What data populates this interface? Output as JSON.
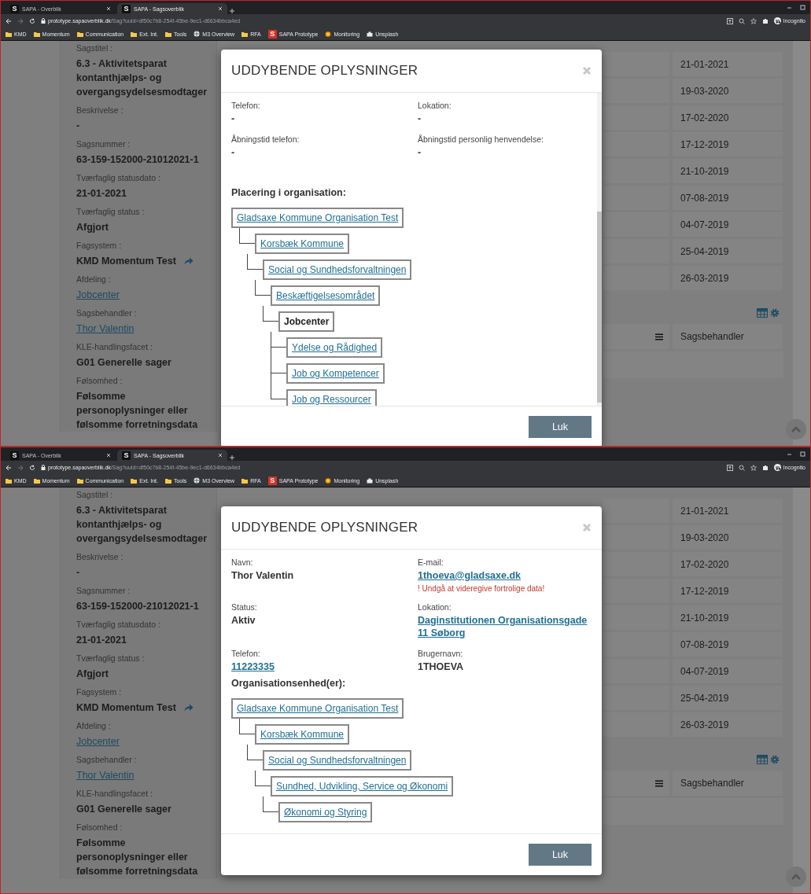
{
  "screens": [
    {
      "browser": {
        "tabs": [
          {
            "title": "SAPA - Overblik",
            "favicon": "S",
            "selected": false
          },
          {
            "title": "SAPA - Sagsoverblik",
            "favicon": "S",
            "selected": true
          }
        ],
        "url_host": "prototype.sapaoverblik.dk",
        "url_path": "/Sag?uuid=df50c7b8-254f-45be-9ec1-d6634bbca4ed",
        "bookmarks": [
          {
            "label": "KMD",
            "kind": "folder"
          },
          {
            "label": "Momentum",
            "kind": "folder"
          },
          {
            "label": "Communication",
            "kind": "folder"
          },
          {
            "label": "Ext. Int.",
            "kind": "folder"
          },
          {
            "label": "Tools",
            "kind": "folder"
          },
          {
            "label": "M3 Overview",
            "kind": "globe"
          },
          {
            "label": "RFA",
            "kind": "folder"
          },
          {
            "label": "SAPA Prototype",
            "kind": "sapa",
            "icon_letter": "S"
          },
          {
            "label": "Monitoring",
            "kind": "monitor"
          },
          {
            "label": "Unsplash",
            "kind": "camera"
          }
        ],
        "profile": "Incognito"
      },
      "case_card": {
        "fields": [
          {
            "label": "Sagstitel :",
            "value": "6.3 - Aktivitetsparat kontanthjælps- og overgangsydelsesmodtager",
            "kind": "text"
          },
          {
            "label": "Beskrivelse :",
            "value": "-",
            "kind": "text"
          },
          {
            "label": "Sagsnummer :",
            "value": "63-159-152000-21012021-1",
            "kind": "text"
          },
          {
            "label": "Tværfaglig statusdato :",
            "value": "21-01-2021",
            "kind": "text"
          },
          {
            "label": "Tværfaglig status :",
            "value": "Afgjort",
            "kind": "text"
          },
          {
            "label": "Fagsystem :",
            "value": "KMD Momentum Test",
            "kind": "external"
          },
          {
            "label": "Afdeling :",
            "value": "Jobcenter",
            "kind": "link"
          },
          {
            "label": "Sagsbehandler :",
            "value": "Thor Valentin",
            "kind": "link"
          },
          {
            "label": "KLE-handlingsfacet :",
            "value": "G01 Generelle sager",
            "kind": "text"
          },
          {
            "label": "Følsomhed :",
            "value": "Følsomme personoplysninger eller følsomme forretningsdata",
            "kind": "text"
          }
        ]
      },
      "case_table": {
        "dates": [
          "21-01-2021",
          "19-03-2020",
          "17-02-2020",
          "17-12-2019",
          "21-10-2019",
          "07-08-2019",
          "04-07-2019",
          "25-04-2019",
          "26-03-2019"
        ],
        "column_header": "Sagsbehandler"
      },
      "modal": {
        "title": "UDDYBENDE OPLYSNINGER",
        "scrolled": true,
        "fields": [
          {
            "label": "Telefon:",
            "value": "-",
            "kind": "text"
          },
          {
            "label": "Lokation:",
            "value": "-",
            "kind": "text"
          },
          {
            "label": "Åbningstid telefon:",
            "value": "-",
            "kind": "text"
          },
          {
            "label": "Åbningstid personlig henvendelse:",
            "value": "-",
            "kind": "text"
          }
        ],
        "section_title": "Placering i organisation:",
        "tree": {
          "label": "Gladsaxe Kommune Organisation Test",
          "kind": "link",
          "children": [
            {
              "label": "Korsbæk Kommune",
              "kind": "link",
              "children": [
                {
                  "label": "Social og Sundhedsforvaltningen",
                  "kind": "link",
                  "children": [
                    {
                      "label": "Beskæftigelsesområdet",
                      "kind": "link",
                      "children": [
                        {
                          "label": "Jobcenter",
                          "kind": "current",
                          "children": [
                            {
                              "label": "Ydelse og Rådighed",
                              "kind": "link"
                            },
                            {
                              "label": "Job og Kompetencer",
                              "kind": "link"
                            },
                            {
                              "label": "Job og Ressourcer",
                              "kind": "link"
                            }
                          ]
                        }
                      ]
                    }
                  ]
                }
              ]
            }
          ]
        },
        "close_button": "Luk"
      }
    },
    {
      "browser": {
        "tabs": [
          {
            "title": "SAPA - Overblik",
            "favicon": "S",
            "selected": false
          },
          {
            "title": "SAPA - Sagsoverblik",
            "favicon": "S",
            "selected": true
          }
        ],
        "url_host": "prototype.sapaoverblik.dk",
        "url_path": "/Sag?uuid=df50c7b8-254f-45be-9ec1-d6634bbca4ed",
        "bookmarks": [
          {
            "label": "KMD",
            "kind": "folder"
          },
          {
            "label": "Momentum",
            "kind": "folder"
          },
          {
            "label": "Communication",
            "kind": "folder"
          },
          {
            "label": "Ext. Int.",
            "kind": "folder"
          },
          {
            "label": "Tools",
            "kind": "folder"
          },
          {
            "label": "M3 Overview",
            "kind": "globe"
          },
          {
            "label": "RFA",
            "kind": "folder"
          },
          {
            "label": "SAPA Prototype",
            "kind": "sapa",
            "icon_letter": "S"
          },
          {
            "label": "Monitoring",
            "kind": "monitor"
          },
          {
            "label": "Unsplash",
            "kind": "camera"
          }
        ],
        "profile": "Incognito"
      },
      "case_card": {
        "fields": [
          {
            "label": "Sagstitel :",
            "value": "6.3 - Aktivitetsparat kontanthjælps- og overgangsydelsesmodtager",
            "kind": "text"
          },
          {
            "label": "Beskrivelse :",
            "value": "-",
            "kind": "text"
          },
          {
            "label": "Sagsnummer :",
            "value": "63-159-152000-21012021-1",
            "kind": "text"
          },
          {
            "label": "Tværfaglig statusdato :",
            "value": "21-01-2021",
            "kind": "text"
          },
          {
            "label": "Tværfaglig status :",
            "value": "Afgjort",
            "kind": "text"
          },
          {
            "label": "Fagsystem :",
            "value": "KMD Momentum Test",
            "kind": "external"
          },
          {
            "label": "Afdeling :",
            "value": "Jobcenter",
            "kind": "link"
          },
          {
            "label": "Sagsbehandler :",
            "value": "Thor Valentin",
            "kind": "link"
          },
          {
            "label": "KLE-handlingsfacet :",
            "value": "G01 Generelle sager",
            "kind": "text"
          },
          {
            "label": "Følsomhed :",
            "value": "Følsomme personoplysninger eller følsomme forretningsdata",
            "kind": "text"
          }
        ]
      },
      "case_table": {
        "dates": [
          "21-01-2021",
          "19-03-2020",
          "17-02-2020",
          "17-12-2019",
          "21-10-2019",
          "07-08-2019",
          "04-07-2019",
          "25-04-2019",
          "26-03-2019"
        ],
        "column_header": "Sagsbehandler"
      },
      "modal": {
        "title": "UDDYBENDE OPLYSNINGER",
        "scrolled": false,
        "fields": [
          {
            "label": "Navn:",
            "value": "Thor Valentin",
            "kind": "text"
          },
          {
            "label": "E-mail:",
            "value": "1thoeva@gladsaxe.dk",
            "kind": "link",
            "note": "! Undgå at videregive fortrolige data!"
          },
          {
            "label": "Status:",
            "value": "Aktiv",
            "kind": "text"
          },
          {
            "label": "Lokation:",
            "value": "Daginstitutionen Organisationsgade 11 Søborg",
            "kind": "link"
          },
          {
            "label": "Telefon:",
            "value": "11223335",
            "kind": "link"
          },
          {
            "label": "Brugernavn:",
            "value": "1THOEVA",
            "kind": "text"
          }
        ],
        "section_title": "Organisationsenhed(er):",
        "tree": {
          "label": "Gladsaxe Kommune Organisation Test",
          "kind": "link",
          "children": [
            {
              "label": "Korsbæk Kommune",
              "kind": "link",
              "children": [
                {
                  "label": "Social og Sundhedsforvaltningen",
                  "kind": "link",
                  "children": [
                    {
                      "label": "Sundhed, Udvikling, Service og Økonomi",
                      "kind": "link",
                      "children": [
                        {
                          "label": "Økonomi og Styring",
                          "kind": "link"
                        }
                      ]
                    }
                  ]
                }
              ]
            }
          ]
        },
        "close_button": "Luk"
      }
    }
  ]
}
